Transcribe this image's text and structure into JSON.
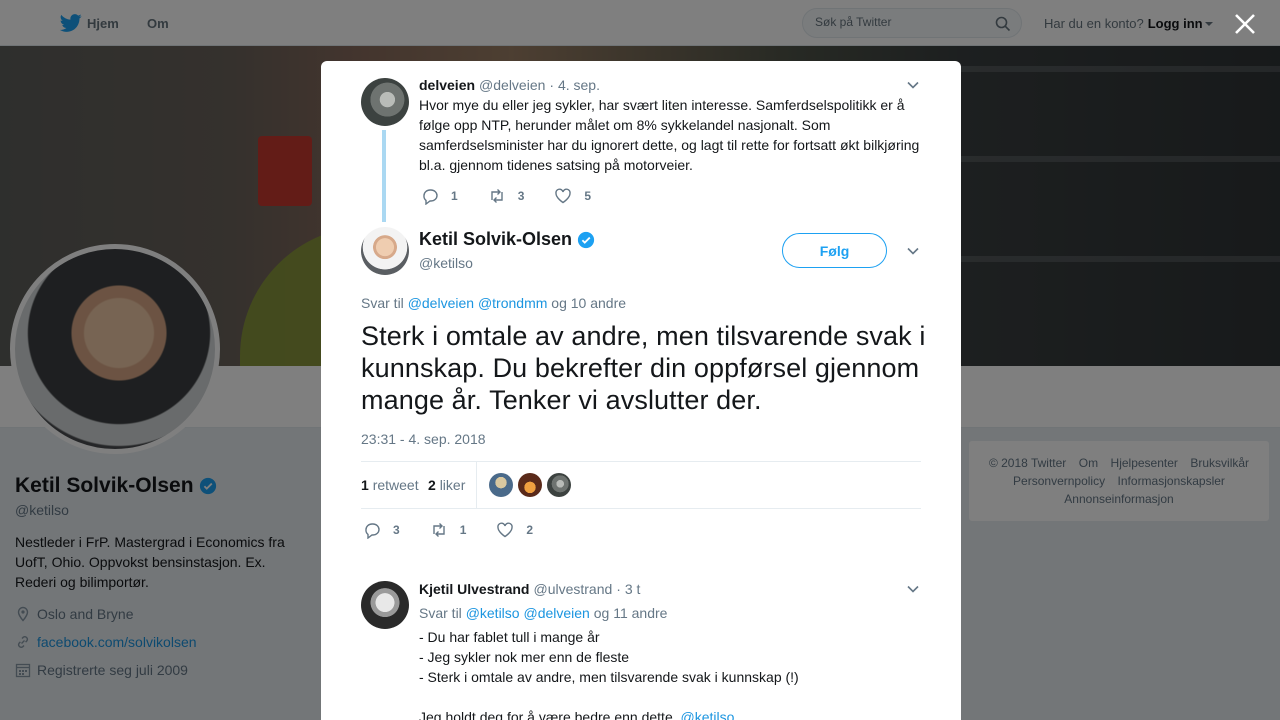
{
  "topbar": {
    "home_label": "Hjem",
    "about_label": "Om",
    "search_placeholder": "Søk på Twitter",
    "account_prompt": "Har du en konto?",
    "login_label": "Logg inn"
  },
  "profile": {
    "name": "Ketil Solvik-Olsen",
    "handle": "@ketilso",
    "bio": "Nestleder i FrP. Mastergrad i Economics fra UofT, Ohio. Oppvokst bensinstasjon. Ex. Rederi og bilimportør.",
    "location": "Oslo and Bryne",
    "website": "facebook.com/solvikolsen",
    "joined": "Registrerte seg juli 2009"
  },
  "footer": {
    "links": [
      "© 2018 Twitter",
      "Om",
      "Hjelpesenter",
      "Bruksvilkår",
      "Personvernpolicy",
      "Informasjonskapsler",
      "Annonseinformasjon"
    ]
  },
  "thread": {
    "parent": {
      "name": "delveien",
      "handle": "@delveien",
      "time": "· 4. sep.",
      "text": "Hvor mye du eller jeg sykler, har svært liten interesse. Samferdselspolitikk er å følge opp NTP, herunder målet om 8% sykkelandel nasjonalt. Som samferdselsminister har du ignorert dette, og lagt til rette for fortsatt økt bilkjøring bl.a. gjennom tidenes satsing på motorveier.",
      "replies": "1",
      "retweets": "3",
      "likes": "5"
    },
    "main": {
      "name": "Ketil Solvik-Olsen",
      "handle": "@ketilso",
      "follow_label": "Følg",
      "reply_prefix": "Svar til",
      "reply_mention1": "@delveien",
      "reply_mention2": "@trondmm",
      "reply_suffix": "og 10 andre",
      "text": "Sterk i omtale av andre, men tilsvarende svak i kunnskap. Du bekrefter din oppførsel gjennom mange år. Tenker vi avslutter der.",
      "timestamp": "23:31 - 4. sep. 2018",
      "retweet_count": "1",
      "retweet_label": "retweet",
      "like_count": "2",
      "like_label": "liker",
      "replies": "3",
      "retweets": "1",
      "likes": "2"
    },
    "reply": {
      "name": "Kjetil Ulvestrand",
      "handle": "@ulvestrand",
      "time": "· 3 t",
      "reply_prefix": "Svar til",
      "reply_mention1": "@ketilso",
      "reply_mention2": "@delveien",
      "reply_suffix": "og 11 andre",
      "line1": "- Du har fablet tull i mange år",
      "line2": "- Jeg sykler nok mer enn de fleste",
      "line3": "- Sterk i omtale av andre, men tilsvarende svak i kunnskap (!)",
      "line4": "Jeg holdt deg for å være bedre enn dette.",
      "line4_mention": "@ketilso"
    }
  },
  "colors": {
    "accent": "#1da1f2",
    "link": "#1b95e0",
    "muted": "#657786",
    "thread_line": "#aad8f2"
  }
}
